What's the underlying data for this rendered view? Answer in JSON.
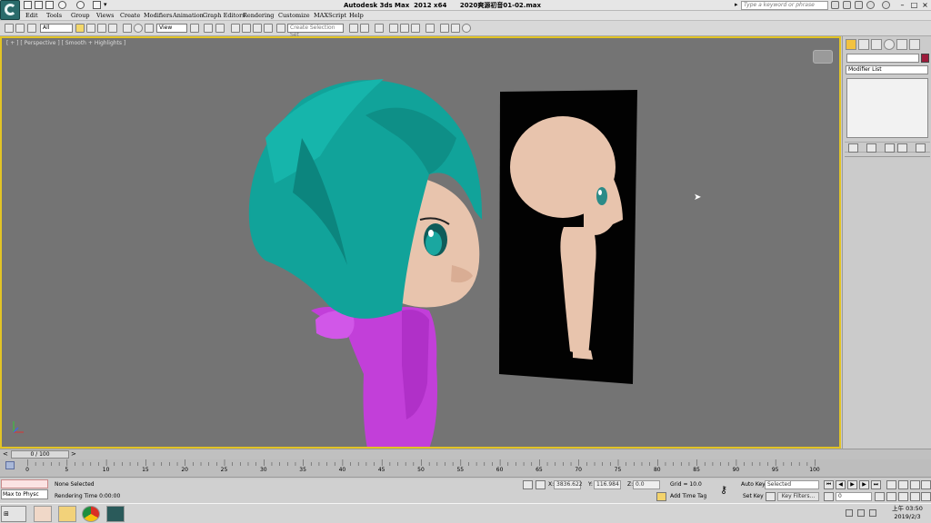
{
  "title": "Autodesk 3ds Max  2012 x64      2020爽源初音01-02.max",
  "search_placeholder": "Type a keyword or phrase",
  "menu": [
    "Edit",
    "Tools",
    "Group",
    "Views",
    "Create",
    "Modifiers",
    "Animation",
    "Graph Editors",
    "Rendering",
    "Customize",
    "MAXScript",
    "Help"
  ],
  "toolbar": {
    "filter": "All",
    "ref_coord": "View",
    "named_sel": "Create Selection Set"
  },
  "viewport": {
    "label": "[ + ] [ Perspective ] [ Smooth + Highlights ]"
  },
  "command_panel": {
    "modifier_list": "Modifier List"
  },
  "timeline": {
    "frame": "0 / 100",
    "ticks": [
      "0",
      "5",
      "10",
      "15",
      "20",
      "25",
      "30",
      "35",
      "40",
      "45",
      "50",
      "55",
      "60",
      "65",
      "70",
      "75",
      "80",
      "85",
      "90",
      "95",
      "100"
    ]
  },
  "status": {
    "maxscript": "Max to Physc",
    "selection": "None Selected",
    "prompt": "Rendering Time  0:00:00",
    "x_label": "X:",
    "x_value": "3836.622",
    "y_label": "Y:",
    "y_value": "116.984",
    "z_label": "Z:",
    "z_value": "0.0",
    "grid": "Grid = 10.0",
    "add_time_tag": "Add Time Tag",
    "auto_key": "Auto Key",
    "set_key": "Set Key",
    "selected": "Selected",
    "key_filters": "Key Filters...",
    "current_frame": "0"
  },
  "taskbar": {
    "clock_time": "上午 03:50",
    "clock_date": "2019/2/3"
  },
  "colors": {
    "viewport_bg": "#747474",
    "active_border": "#e2c425",
    "hair": "#11a39a",
    "body_suit": "#c23fd9",
    "skin": "#e8c4ad",
    "object_color": "#9c1a3a"
  }
}
